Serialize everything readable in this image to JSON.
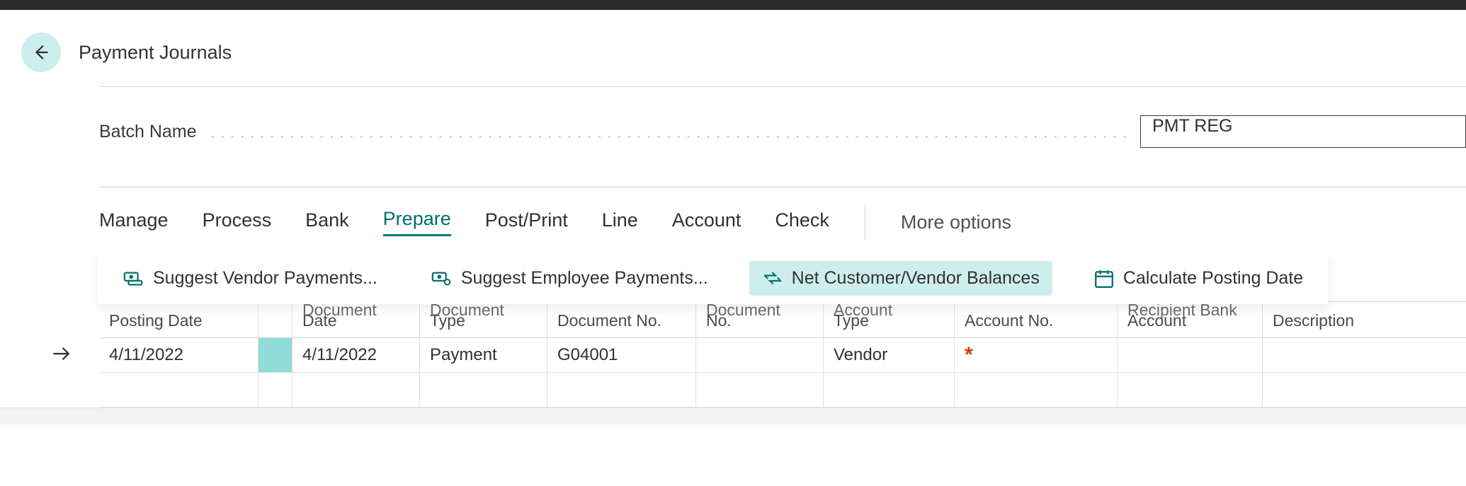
{
  "page": {
    "title": "Payment Journals"
  },
  "batch": {
    "label": "Batch Name",
    "value": "PMT REG"
  },
  "tabs": {
    "manage": "Manage",
    "process": "Process",
    "bank": "Bank",
    "prepare": "Prepare",
    "post_print": "Post/Print",
    "line": "Line",
    "account": "Account",
    "check": "Check",
    "more": "More options"
  },
  "prepare_actions": {
    "suggest_vendor": "Suggest Vendor Payments...",
    "suggest_employee": "Suggest Employee Payments...",
    "net_balances": "Net Customer/Vendor Balances",
    "calc_posting": "Calculate Posting Date"
  },
  "grid": {
    "headers": {
      "posting_date": "Posting Date",
      "document_date_upper": "Document",
      "document_date": "Date",
      "document_type_upper": "Document",
      "document_type": "Type",
      "document_no": "Document No.",
      "ext_doc_upper": "Document",
      "ext_doc": "No.",
      "account_type_upper": "Account",
      "account_type": "Type",
      "account_no": "Account No.",
      "recipient_upper": "Recipient Bank",
      "recipient": "Account",
      "description": "Description"
    },
    "row1": {
      "posting_date": "4/11/2022",
      "document_date": "4/11/2022",
      "document_type": "Payment",
      "document_no": "G04001",
      "ext_doc": "",
      "account_type": "Vendor",
      "account_no_marker": "*",
      "recipient": "",
      "description": ""
    }
  }
}
